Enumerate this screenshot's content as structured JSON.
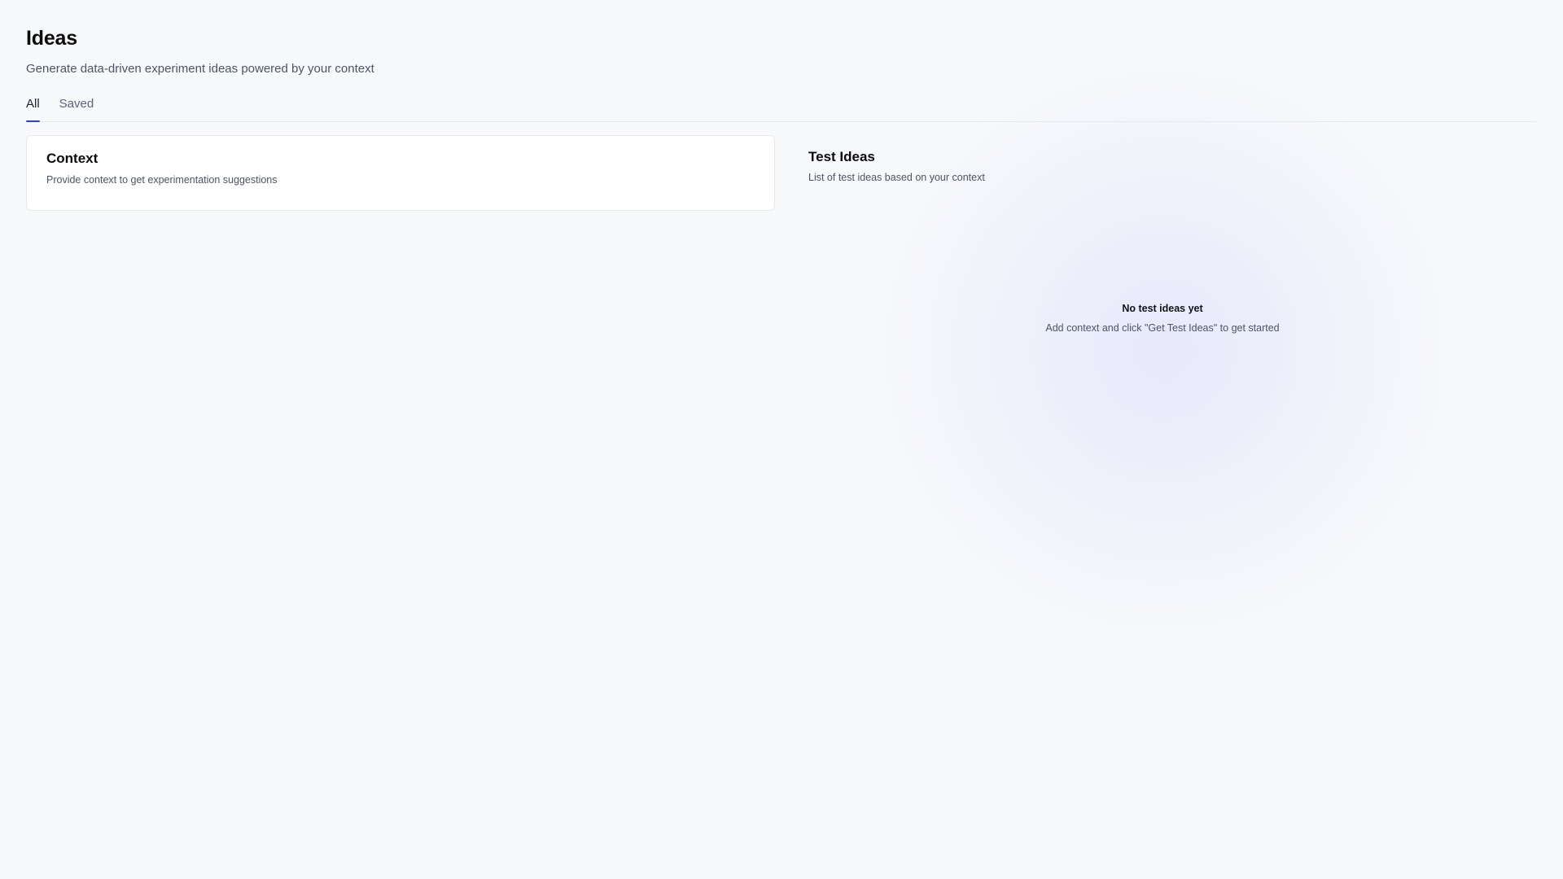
{
  "header": {
    "title": "Ideas",
    "subtitle": "Generate data-driven experiment ideas powered by your context"
  },
  "tabs": [
    {
      "label": "All",
      "active": true
    },
    {
      "label": "Saved",
      "active": false
    }
  ],
  "context_card": {
    "title": "Context",
    "description": "Provide context to get experimentation suggestions"
  },
  "test_ideas": {
    "title": "Test Ideas",
    "description": "List of test ideas based on your context",
    "empty_title": "No test ideas yet",
    "empty_text": "Add context and click \"Get Test Ideas\" to get started"
  },
  "colors": {
    "accent": "#2f3fd6",
    "background": "#f8f9fb",
    "glow": "#7c84ff"
  }
}
